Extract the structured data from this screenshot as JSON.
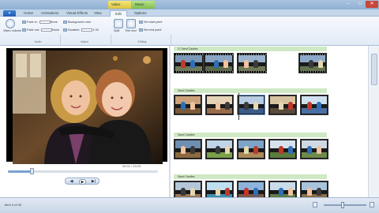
{
  "window": {
    "context_tabs": {
      "video": "Video Tools",
      "music": "Music Tools"
    },
    "controls": {
      "minimize": "–",
      "maximize": "□",
      "close": "✕"
    }
  },
  "ribbon_tabs": {
    "app_button": "▾",
    "items": [
      "Home",
      "Animations",
      "Visual Effects",
      "View",
      "Edit",
      "Options"
    ],
    "active_index": 4
  },
  "ribbon": {
    "video_volume": "Video volume",
    "fade_in": {
      "label": "Fade in:",
      "value": "None"
    },
    "fade_out": {
      "label": "Fade out:",
      "value": "None"
    },
    "background_color": "Background color",
    "duration": {
      "label": "Duration:",
      "value": "1.00"
    },
    "adjust_label": "Adjust",
    "split_label": "Split",
    "trim_tool": "Trim tool",
    "set_start": "Set start point",
    "set_end": "Set end point",
    "editing_label": "Editing",
    "audio_label": "Audio"
  },
  "preview": {
    "timecode": "00:01 / 03:25",
    "progress": 0.16,
    "buttons": {
      "prev": "◀",
      "play": "▶",
      "next": "▶|"
    }
  },
  "storyboard": {
    "rows": [
      {
        "label": "Sand Castles",
        "checked": true
      },
      {
        "label": "Sand Castles",
        "checked": false
      },
      {
        "label": "Sand Castles",
        "checked": false
      },
      {
        "label": "Sand Castles",
        "checked": false
      }
    ]
  },
  "status": {
    "text": "Item 4 of 30"
  },
  "colors": {
    "accent": "#6f9fd5",
    "label_bar": "#cfe9c4",
    "ribbon": "#e2ebf6"
  }
}
